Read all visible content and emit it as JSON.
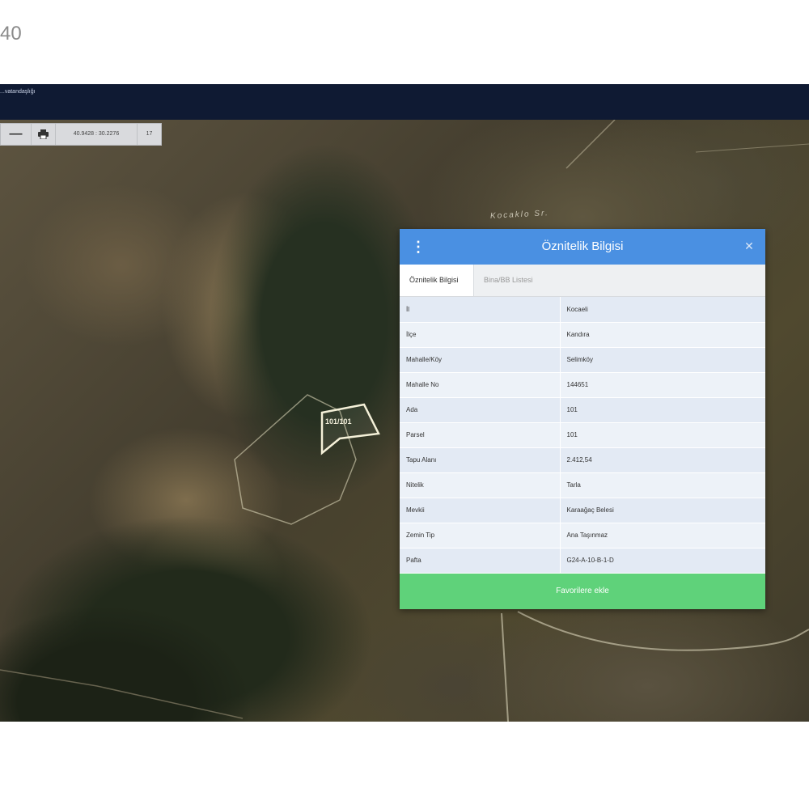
{
  "page": {
    "corner_text": "40"
  },
  "app": {
    "title": "...vatandaşlığı"
  },
  "toolbar": {
    "zoom_out_icon": "minus-icon",
    "print_icon": "printer-icon",
    "coordinates": "40.9428 : 30.2276",
    "zoom_level": "17"
  },
  "map": {
    "road_label": "Kocaklo Sr.",
    "parcel_label": "101/101"
  },
  "dialog": {
    "title": "Öznitelik Bilgisi",
    "menu_icon": "kebab-menu-icon",
    "close_icon": "close-icon",
    "tabs": [
      {
        "label": "Öznitelik Bilgisi",
        "active": true
      },
      {
        "label": "Bina/BB Listesi",
        "active": false
      }
    ],
    "rows": [
      {
        "key": "İl",
        "value": "Kocaeli"
      },
      {
        "key": "İlçe",
        "value": "Kandıra"
      },
      {
        "key": "Mahalle/Köy",
        "value": "Selimköy"
      },
      {
        "key": "Mahalle No",
        "value": "144651"
      },
      {
        "key": "Ada",
        "value": "101"
      },
      {
        "key": "Parsel",
        "value": "101"
      },
      {
        "key": "Tapu Alanı",
        "value": "2.412,54"
      },
      {
        "key": "Nitelik",
        "value": "Tarla"
      },
      {
        "key": "Mevkii",
        "value": "Karaağaç Belesi"
      },
      {
        "key": "Zemin Tip",
        "value": "Ana Taşınmaz"
      },
      {
        "key": "Pafta",
        "value": "G24-A-10-B-1-D"
      }
    ],
    "favorite_button": "Favorilere ekle"
  },
  "colors": {
    "header_blue": "#4a90e2",
    "favorite_green": "#5fd27a",
    "topbar_navy": "#0f1a33"
  }
}
